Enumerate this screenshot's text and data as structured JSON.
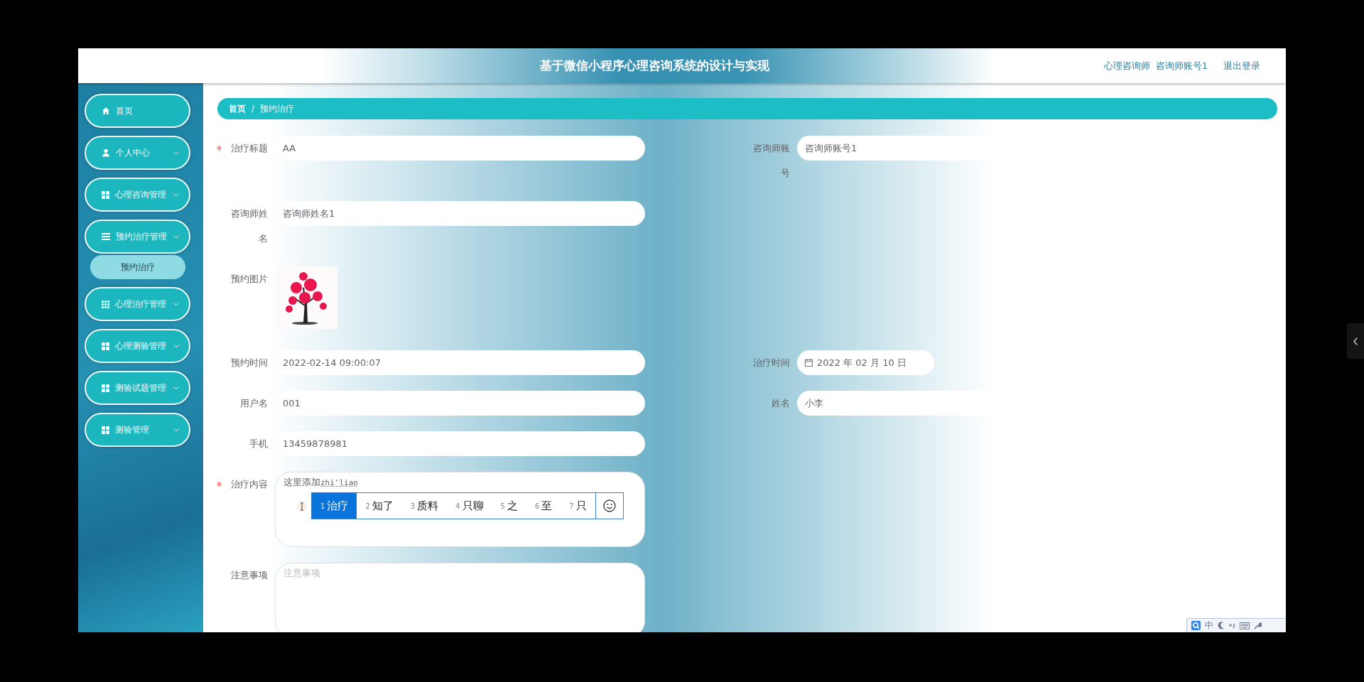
{
  "header": {
    "title": "基于微信小程序心理咨询系统的设计与实现",
    "user_role": "心理咨询师",
    "user_account": "咨询师账号1",
    "logout": "退出登录"
  },
  "sidebar": {
    "items": [
      {
        "label": "首页",
        "kind": "link"
      },
      {
        "label": "个人中心",
        "kind": "submenu"
      },
      {
        "label": "心理咨询管理",
        "kind": "submenu"
      },
      {
        "label": "预约治疗管理",
        "kind": "submenu",
        "expanded": true,
        "children": [
          {
            "label": "预约治疗",
            "selected": true
          }
        ]
      },
      {
        "label": "心理治疗管理",
        "kind": "submenu"
      },
      {
        "label": "心理测验管理",
        "kind": "submenu"
      },
      {
        "label": "测验试题管理",
        "kind": "submenu"
      },
      {
        "label": "测验管理",
        "kind": "submenu"
      }
    ]
  },
  "breadcrumb": {
    "items": [
      "首页",
      "预约治疗"
    ],
    "separator": "/"
  },
  "form": {
    "rows": [
      {
        "fields": [
          {
            "kind": "text",
            "label": "治疗标题",
            "required": true,
            "value": "AA"
          },
          {
            "kind": "text",
            "label": "咨询师账号",
            "required": false,
            "value": "咨询师账号1"
          }
        ]
      },
      {
        "fields": [
          {
            "kind": "text",
            "label": "咨询师姓名",
            "required": false,
            "value": "咨询师姓名1"
          }
        ]
      },
      {
        "fields": [
          {
            "label": "预约图片",
            "required": false
          }
        ]
      },
      {
        "fields": [
          {
            "kind": "text",
            "label": "预约时间",
            "required": false,
            "value": "2022-02-14 09:00:07"
          },
          {
            "kind": "date",
            "label": "治疗时间",
            "required": false,
            "value": "2022 年 02 月 10 日"
          }
        ]
      },
      {
        "fields": [
          {
            "kind": "text",
            "label": "用户名",
            "required": false,
            "value": "001"
          },
          {
            "kind": "text",
            "label": "姓名",
            "required": false,
            "value": "小李"
          }
        ]
      },
      {
        "fields": [
          {
            "kind": "text",
            "label": "手机",
            "required": false,
            "value": "13459878981"
          }
        ]
      },
      {
        "fields": [
          {
            "kind": "textarea",
            "label": "治疗内容",
            "required": true,
            "value": "这里添加",
            "composition": "zhi'liao",
            "ime": {
              "candidates": [
                {
                  "index": "1",
                  "text": "治疗",
                  "selected": true
                },
                {
                  "index": "2",
                  "text": "知了",
                  "selected": false
                },
                {
                  "index": "3",
                  "text": "质料",
                  "selected": false
                },
                {
                  "index": "4",
                  "text": "只聊",
                  "selected": false
                },
                {
                  "index": "5",
                  "text": "之",
                  "selected": false
                },
                {
                  "index": "6",
                  "text": "至",
                  "selected": false
                },
                {
                  "index": "7",
                  "text": "只",
                  "selected": false
                }
              ]
            }
          }
        ]
      },
      {
        "fields": [
          {
            "kind": "textarea",
            "label": "注意事项",
            "required": false,
            "placeholder": "注意事项"
          }
        ]
      }
    ]
  },
  "ime_toolbar": {
    "mode": "中"
  }
}
